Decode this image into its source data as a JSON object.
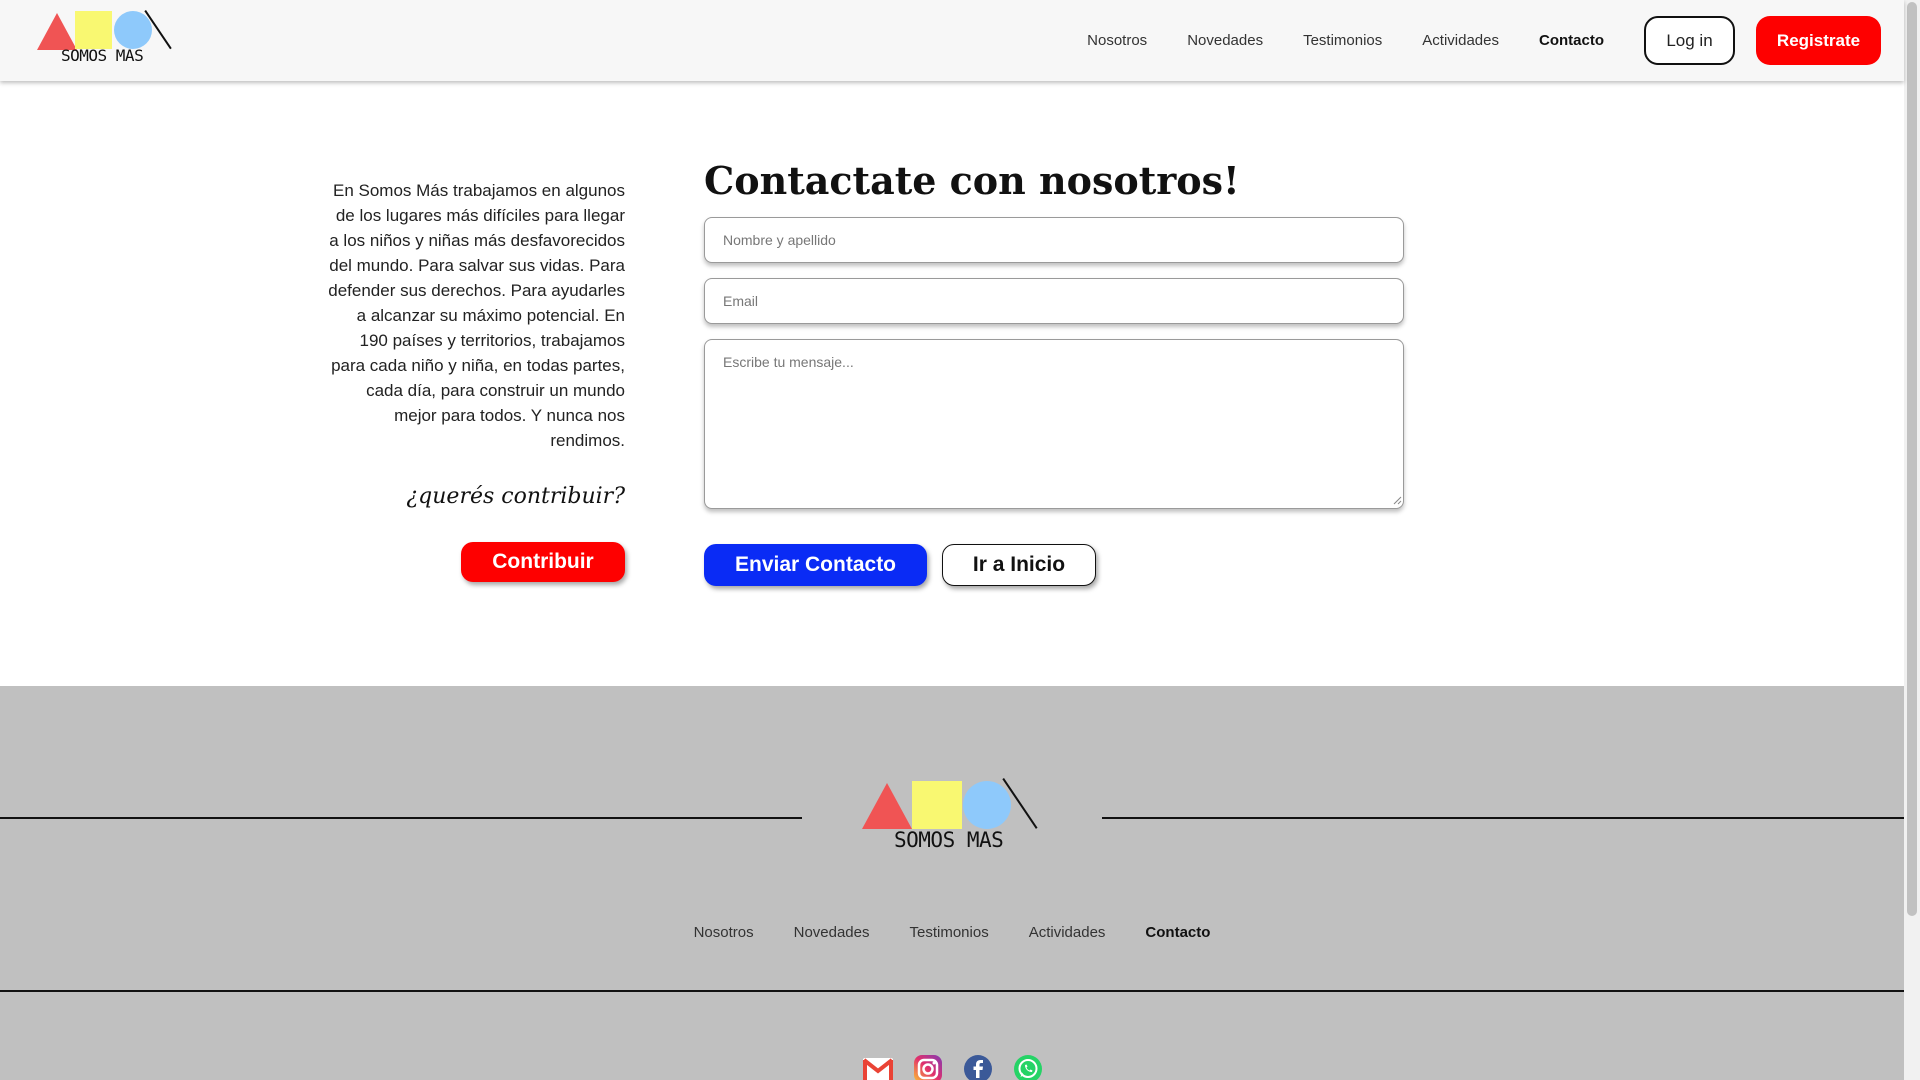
{
  "header": {
    "logo_text": "SOMOS MAS",
    "nav": [
      {
        "label": "Nosotros"
      },
      {
        "label": "Novedades"
      },
      {
        "label": "Testimonios"
      },
      {
        "label": "Actividades"
      },
      {
        "label": "Contacto",
        "active": true
      }
    ],
    "login_label": "Log in",
    "register_label": "Registrate"
  },
  "left": {
    "description": "En Somos Más trabajamos en algunos de los lugares más difíciles para llegar a los niños y niñas más desfavorecidos del mundo. Para salvar sus vidas. Para defender sus derechos. Para ayudarles a alcanzar su máximo potencial. En 190 países y territorios, trabajamos para cada niño y niña, en todas partes, cada día, para construir un mundo mejor para todos. Y nunca nos rendimos.",
    "question": "¿querés contribuir?",
    "contribute_label": "Contribuir"
  },
  "form": {
    "title": "Contactate con nosotros!",
    "name_placeholder": "Nombre y apellido",
    "email_placeholder": "Email",
    "message_placeholder": "Escribe tu mensaje...",
    "submit_label": "Enviar Contacto",
    "home_label": "Ir a Inicio"
  },
  "footer": {
    "logo_text": "SOMOS MAS",
    "nav": [
      {
        "label": "Nosotros"
      },
      {
        "label": "Novedades"
      },
      {
        "label": "Testimonios"
      },
      {
        "label": "Actividades"
      },
      {
        "label": "Contacto",
        "active": true
      }
    ],
    "social": [
      "gmail-icon",
      "instagram-icon",
      "facebook-icon",
      "whatsapp-icon"
    ]
  },
  "colors": {
    "brand_red": "#fe0000",
    "brand_blue": "#0a2bf5",
    "logo_red": "#f05454",
    "logo_yellow": "#f9f871",
    "logo_blue": "#8ec9fb",
    "footer_bg": "#c0c0c0"
  }
}
